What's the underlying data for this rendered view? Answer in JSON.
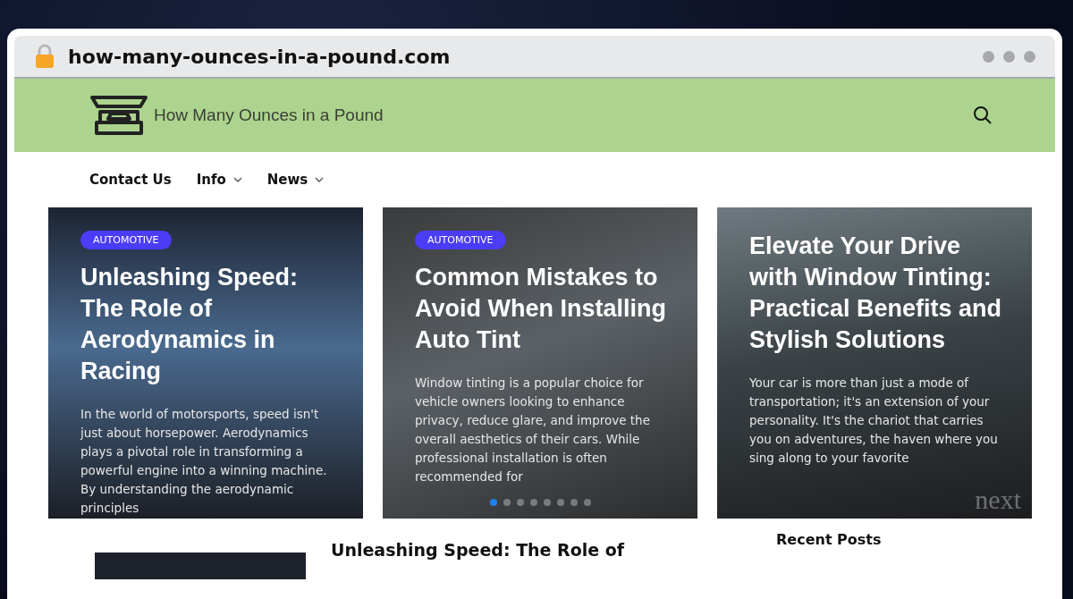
{
  "browser": {
    "url": "how-many-ounces-in-a-pound.com"
  },
  "header": {
    "site_title": "How Many Ounces in a Pound"
  },
  "nav": [
    {
      "label": "Contact Us",
      "has_dropdown": false
    },
    {
      "label": "Info",
      "has_dropdown": true
    },
    {
      "label": "News",
      "has_dropdown": true
    }
  ],
  "slider": {
    "next_label": "next",
    "slides": [
      {
        "category": "AUTOMOTIVE",
        "title": "Unleashing Speed: The Role of Aerodynamics in Racing",
        "excerpt": "In the world of motorsports, speed isn't just about horsepower. Aerodynamics plays a pivotal role in transforming a powerful engine into a winning machine. By understanding the aerodynamic principles"
      },
      {
        "category": "AUTOMOTIVE",
        "title": "Common Mistakes to Avoid When Installing Auto Tint",
        "excerpt": "Window tinting is a popular choice for vehicle owners looking to enhance privacy, reduce glare, and improve the overall aesthetics of their cars. While professional installation is often recommended for"
      },
      {
        "title": "Elevate Your Drive with Window Tinting: Practical Benefits and Stylish Solutions",
        "excerpt": "Your car is more than just a mode of transportation; it's an extension of your personality. It's the chariot that carries you on adventures, the haven where you sing along to your favorite"
      }
    ],
    "dots": [
      {
        "selected": true
      },
      {
        "selected": false
      },
      {
        "selected": false
      },
      {
        "selected": false
      },
      {
        "selected": false
      },
      {
        "selected": false
      },
      {
        "selected": false
      },
      {
        "selected": false
      }
    ]
  },
  "latest": {
    "title": "Unleashing Speed: The Role of"
  },
  "sidebar": {
    "heading": "Recent Posts"
  }
}
